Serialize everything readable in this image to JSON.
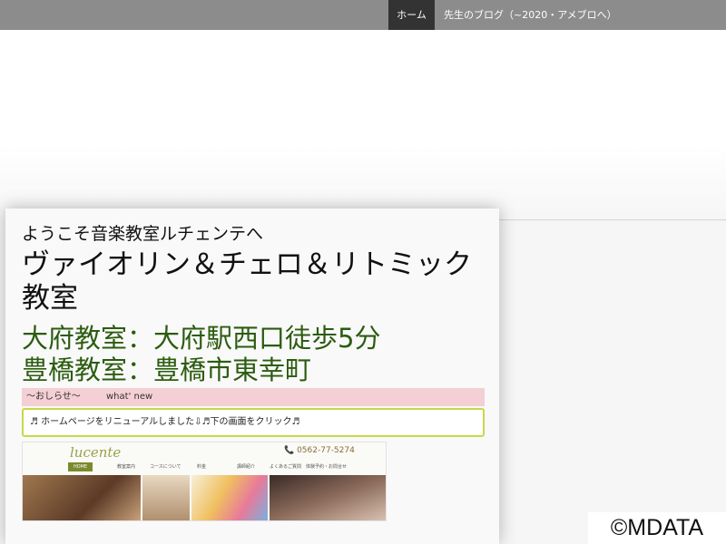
{
  "nav": {
    "home": "ホーム",
    "blog": "先生のブログ（~2020・アメブロへ）"
  },
  "main": {
    "welcome": "ようこそ音楽教室ルチェンテへ",
    "title": "ヴァイオリン＆チェロ＆リトミック教室",
    "location1": "大府教室：大府駅西口徒歩5分",
    "location2": "豊橋教室：豊橋市東幸町",
    "news_header_left": "～おしらせ～",
    "news_header_right": "what' new",
    "news_text": "♬ ホームページをリニューアルしました⇩♬下の画面をクリック♬"
  },
  "thumbnail": {
    "logo": "lucente",
    "phone": "📞 0562-77-5274",
    "nav": [
      "HOME",
      "教室案内",
      "コースについて",
      "料金",
      "講師紹介",
      "よくあるご質問",
      "体験予約・お問合せ"
    ]
  },
  "watermark": "©MDATA",
  "colors": {
    "nav_bg": "#8c8c8c",
    "nav_active": "#333333",
    "location_text": "#2b5c0f",
    "news_header_bg": "#f4cfd3",
    "news_border": "#c8d84a"
  }
}
